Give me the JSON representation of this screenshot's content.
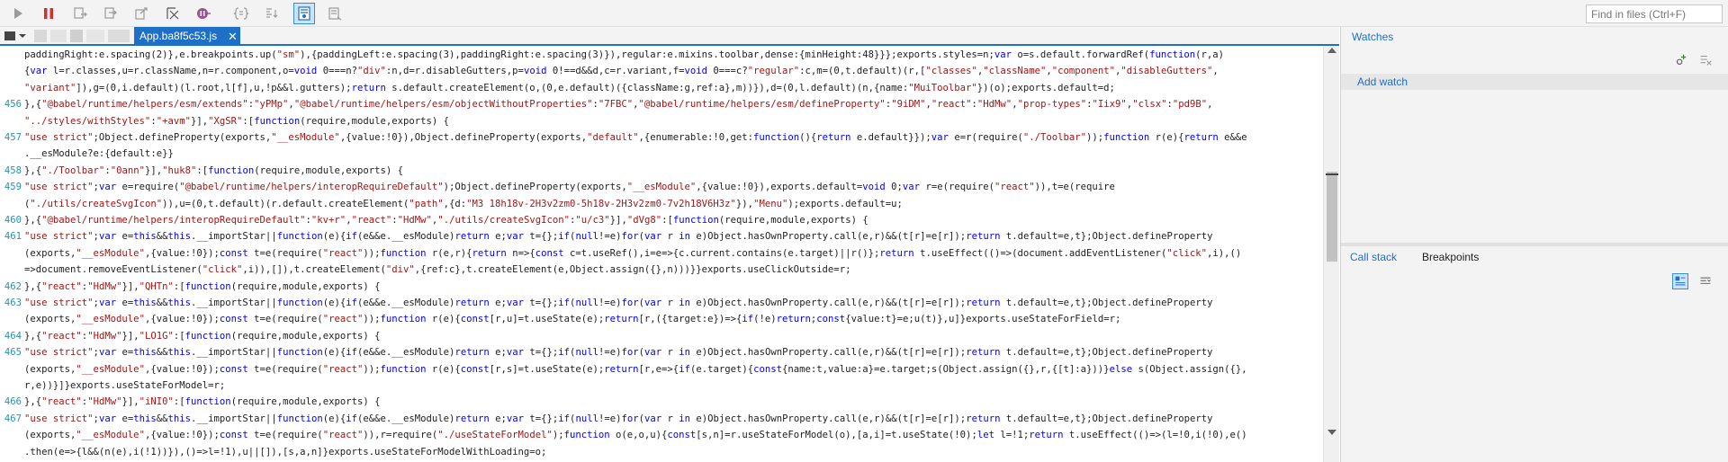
{
  "toolbar": {
    "buttons": [
      "play-icon",
      "pause-icon",
      "step-over-icon",
      "step-into-icon",
      "step-out-icon",
      "break-on-new-worker-icon",
      "exception-behavior-icon",
      "source-map-icon",
      "pretty-print-icon",
      "just-my-code-icon",
      "breakpoints-toggle-icon"
    ],
    "find_placeholder": "Find in files (Ctrl+F)"
  },
  "tabs": {
    "active_label": "App.ba8f5c53.js",
    "close_symbol": "✕"
  },
  "code": [
    {
      "n": "",
      "t": "paddingRight:e.spacing(2)},e.breakpoints.up(\"sm\"),{paddingLeft:e.spacing(3),paddingRight:e.spacing(3)}),regular:e.mixins.toolbar,dense:{minHeight:48}}};exports.styles=n;var o=s.default.forwardRef(function(r,a)"
    },
    {
      "n": "",
      "t": "{var l=r.classes,u=r.className,n=r.component,o=void 0===n?\"div\":n,d=r.disableGutters,p=void 0!==d&&d,c=r.variant,f=void 0===c?\"regular\":c,m=(0,t.default)(r,[\"classes\",\"className\",\"component\",\"disableGutters\","
    },
    {
      "n": "",
      "t": "\"variant\"]),g=(0,i.default)(l.root,l[f],u,!p&&l.gutters);return s.default.createElement(o,(0,e.default)({className:g,ref:a},m))}),d=(0,l.default)(n,{name:\"MuiToolbar\"})(o);exports.default=d;"
    },
    {
      "n": "456",
      "t": "},{\"@babel/runtime/helpers/esm/extends\":\"yPMp\",\"@babel/runtime/helpers/esm/objectWithoutProperties\":\"7FBC\",\"@babel/runtime/helpers/esm/defineProperty\":\"9iDM\",\"react\":\"HdMw\",\"prop-types\":\"Iix9\",\"clsx\":\"pd9B\","
    },
    {
      "n": "",
      "t": "\"../styles/withStyles\":\"+avm\"}],\"XgSR\":[function(require,module,exports) {"
    },
    {
      "n": "457",
      "t": "\"use strict\";Object.defineProperty(exports,\"__esModule\",{value:!0}),Object.defineProperty(exports,\"default\",{enumerable:!0,get:function(){return e.default}});var e=r(require(\"./Toolbar\"));function r(e){return e&&e"
    },
    {
      "n": "",
      "t": ".__esModule?e:{default:e}}"
    },
    {
      "n": "458",
      "t": "},{\"./Toolbar\":\"0ann\"}],\"huk8\":[function(require,module,exports) {"
    },
    {
      "n": "459",
      "t": "\"use strict\";var e=require(\"@babel/runtime/helpers/interopRequireDefault\");Object.defineProperty(exports,\"__esModule\",{value:!0}),exports.default=void 0;var r=e(require(\"react\")),t=e(require"
    },
    {
      "n": "",
      "t": "(\"./utils/createSvgIcon\")),u=(0,t.default)(r.default.createElement(\"path\",{d:\"M3 18h18v-2H3v2zm0-5h18v-2H3v2zm0-7v2h18V6H3z\"}),\"Menu\");exports.default=u;"
    },
    {
      "n": "460",
      "t": "},{\"@babel/runtime/helpers/interopRequireDefault\":\"kv+r\",\"react\":\"HdMw\",\"./utils/createSvgIcon\":\"u/c3\"}],\"dVg8\":[function(require,module,exports) {"
    },
    {
      "n": "461",
      "t": "\"use strict\";var e=this&&this.__importStar||function(e){if(e&&e.__esModule)return e;var t={};if(null!=e)for(var r in e)Object.hasOwnProperty.call(e,r)&&(t[r]=e[r]);return t.default=e,t};Object.defineProperty"
    },
    {
      "n": "",
      "t": "(exports,\"__esModule\",{value:!0});const t=e(require(\"react\"));function r(e,r){return n=>{const c=t.useRef(),i=e=>{c.current.contains(e.target)||r()};return t.useEffect(()=>(document.addEventListener(\"click\",i),()"
    },
    {
      "n": "",
      "t": "=>document.removeEventListener(\"click\",i)),[]),t.createElement(\"div\",{ref:c},t.createElement(e,Object.assign({},n)))}}exports.useClickOutside=r;"
    },
    {
      "n": "462",
      "t": "},{\"react\":\"HdMw\"}],\"QHTn\":[function(require,module,exports) {"
    },
    {
      "n": "463",
      "t": "\"use strict\";var e=this&&this.__importStar||function(e){if(e&&e.__esModule)return e;var t={};if(null!=e)for(var r in e)Object.hasOwnProperty.call(e,r)&&(t[r]=e[r]);return t.default=e,t};Object.defineProperty"
    },
    {
      "n": "",
      "t": "(exports,\"__esModule\",{value:!0});const t=e(require(\"react\"));function r(e){const[r,u]=t.useState(e);return[r,({target:e})=>{if(!e)return;const{value:t}=e;u(t)},u]}exports.useStateForField=r;"
    },
    {
      "n": "464",
      "t": "},{\"react\":\"HdMw\"}],\"LO1G\":[function(require,module,exports) {"
    },
    {
      "n": "465",
      "t": "\"use strict\";var e=this&&this.__importStar||function(e){if(e&&e.__esModule)return e;var t={};if(null!=e)for(var r in e)Object.hasOwnProperty.call(e,r)&&(t[r]=e[r]);return t.default=e,t};Object.defineProperty"
    },
    {
      "n": "",
      "t": "(exports,\"__esModule\",{value:!0});const t=e(require(\"react\"));function r(e){const[r,s]=t.useState(e);return[r,e=>{if(e.target){const{name:t,value:a}=e.target;s(Object.assign({},r,{[t]:a}))}else s(Object.assign({},"
    },
    {
      "n": "",
      "t": "r,e))}]}exports.useStateForModel=r;"
    },
    {
      "n": "466",
      "t": "},{\"react\":\"HdMw\"}],\"iNI0\":[function(require,module,exports) {"
    },
    {
      "n": "467",
      "t": "\"use strict\";var e=this&&this.__importStar||function(e){if(e&&e.__esModule)return e;var t={};if(null!=e)for(var r in e)Object.hasOwnProperty.call(e,r)&&(t[r]=e[r]);return t.default=e,t};Object.defineProperty"
    },
    {
      "n": "",
      "t": "(exports,\"__esModule\",{value:!0});const t=e(require(\"react\")),r=require(\"./useStateForModel\");function o(e,o,u){const[s,n]=r.useStateForModel(o),[a,i]=t.useState(!0);let l=!1;return t.useEffect(()=>(l=!0,i(!0),e()"
    },
    {
      "n": "",
      "t": ".then(e=>{l&&(n(e),i(!1))}),()=>l=!1),u||[]),[s,a,n]}exports.useStateForModelWithLoading=o;"
    }
  ],
  "watches": {
    "header": "Watches",
    "add_watch": "Add watch"
  },
  "callstack": {
    "tab_callstack": "Call stack",
    "tab_breakpoints": "Breakpoints"
  },
  "colors": {
    "accent": "#1e6fc6",
    "keyword": "#0000ff",
    "string": "#a31515",
    "line_number": "#2b91af"
  }
}
